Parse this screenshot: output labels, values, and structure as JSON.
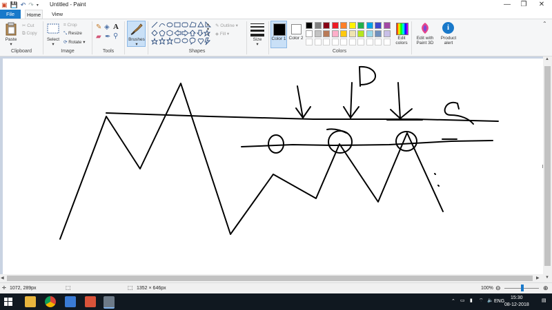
{
  "window": {
    "title": "Untitled - Paint",
    "min": "—",
    "max": "❐",
    "close": "✕"
  },
  "tabs": {
    "file": "File",
    "home": "Home",
    "view": "View"
  },
  "ribbon": {
    "clipboard": {
      "label": "Clipboard",
      "paste": "Paste",
      "cut": "Cut",
      "copy": "Copy"
    },
    "image": {
      "label": "Image",
      "select": "Select",
      "crop": "Crop",
      "resize": "Resize",
      "rotate": "Rotate"
    },
    "tools": {
      "label": "Tools"
    },
    "brushes": {
      "label": "Brushes"
    },
    "shapes": {
      "label": "Shapes",
      "outline": "Outline",
      "fill": "Fill"
    },
    "size": {
      "label": "Size"
    },
    "colors": {
      "label": "Colors",
      "color1": "Color 1",
      "color2": "Color 2",
      "edit": "Edit colors",
      "row1": [
        "#000000",
        "#7f7f7f",
        "#880015",
        "#ed1c24",
        "#ff7f27",
        "#fff200",
        "#22b14c",
        "#00a2e8",
        "#3f48cc",
        "#a349a4"
      ],
      "row2": [
        "#ffffff",
        "#c3c3c3",
        "#b97a57",
        "#ffaec9",
        "#ffc90e",
        "#efe4b0",
        "#b5e61d",
        "#99d9ea",
        "#7092be",
        "#c8bfe7"
      ]
    },
    "paint3d": "Edit with Paint 3D",
    "alert": "Product alert"
  },
  "status": {
    "cursor": "1072, 289px",
    "dimensions": "1352 × 646px",
    "zoom": "100%"
  },
  "taskbar": {
    "lang": "ENG",
    "time": "15:30",
    "date": "08-12-2018"
  },
  "drawing": {
    "letter_d": "D",
    "letter_s": "S"
  }
}
